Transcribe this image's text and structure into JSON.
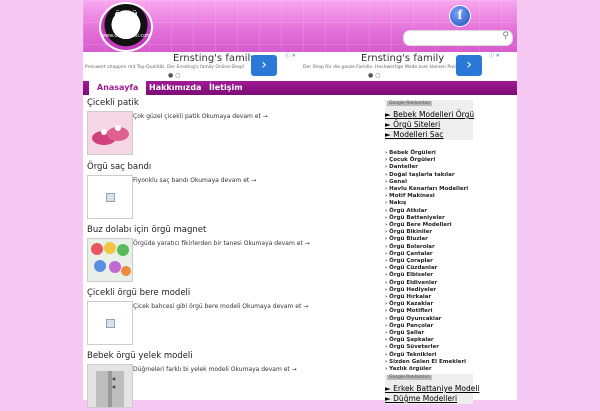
{
  "header": {
    "logo_text_top": "ÖRGÜ SİTESİ",
    "logo_text_bottom": "www.orgusitesi.com",
    "facebook_label": "f",
    "search_placeholder": ""
  },
  "ads": [
    {
      "title": "Ernsting's family",
      "desc": "Preiswert shoppen mit Top-Qualität. Der Ernsting's family Online-Shop!",
      "dots": "● ○",
      "arrow": "›",
      "adx": "ⓘ ✕"
    },
    {
      "title": "Ernsting's family",
      "desc": "Der Shop für die ganze Familie. Hochwertige Mode zum kleinen Preis!",
      "dots": "● ○",
      "arrow": "›",
      "adx": "ⓘ ✕"
    }
  ],
  "nav": {
    "tabs": [
      {
        "label": "Anasayfa",
        "active": true
      },
      {
        "label": "Hakkımızda",
        "active": false
      },
      {
        "label": "İletişim",
        "active": false
      }
    ]
  },
  "posts": [
    {
      "title": "Çicekli patik",
      "excerpt": "Çok güzel çicekli patik Okumaya devam et →",
      "thumb_color": "#e26a9a"
    },
    {
      "title": "Örgü saç bandı",
      "excerpt": "Fiyonklu saç bandı Okumaya devam et →",
      "thumb_color": ""
    },
    {
      "title": "Buz dolabı için örgü magnet",
      "excerpt": "Örgüde yaratıcı fikirlerden bir tanesi Okumaya devam et →",
      "thumb_color": "#8fc9a0"
    },
    {
      "title": "Çicekli örgü bere modeli",
      "excerpt": "Çicek bahcesi gibi örgü bere modeli Okumaya devam et →",
      "thumb_color": ""
    },
    {
      "title": "Bebek örgü yelek modeli",
      "excerpt": "Düğmeleri farklı bi yelek modeli Okumaya devam et →",
      "thumb_color": "#cfcfcf"
    }
  ],
  "sidebar": {
    "google_label": "Google Reklamları",
    "links1": [
      "► Bebek Modelleri Örgü",
      "► Örgü Siteleri",
      "► Modelleri Saç"
    ],
    "categories": [
      "Bebek Örgüleri",
      "Çocuk Örgüleri",
      "Danteller",
      "Doğal taşlarla takılar",
      "Genel",
      "Havlu Kenarları Modelleri",
      "Motif Makinesi",
      "Nakış",
      "Örgü Atkılar",
      "Örgü Battaniyeler",
      "Örgü Bere Modelleri",
      "Örgü Bikiniler",
      "Örgü Bluzlar",
      "Örgü Bolerolar",
      "Örgü Çantalar",
      "Örgü Çoraplar",
      "Örgü Cüzdanlar",
      "Örgü Elbiseler",
      "Örgü Eldivenler",
      "Örgü Hediyeler",
      "Örgü Hırkalar",
      "Örgü Kazaklar",
      "Örgü Motifleri",
      "Örgü Oyuncaklar",
      "Örgü Pançolar",
      "Örgü Şallar",
      "Örgü Şapkalar",
      "Örgü Süveterler",
      "Örgü Teknikleri",
      "Sizden Gelen El Emekleri",
      "Yazlık örgüler"
    ],
    "links2": [
      "► Erkek Battaniye Modeli",
      "► Düğme Modelleri"
    ]
  }
}
